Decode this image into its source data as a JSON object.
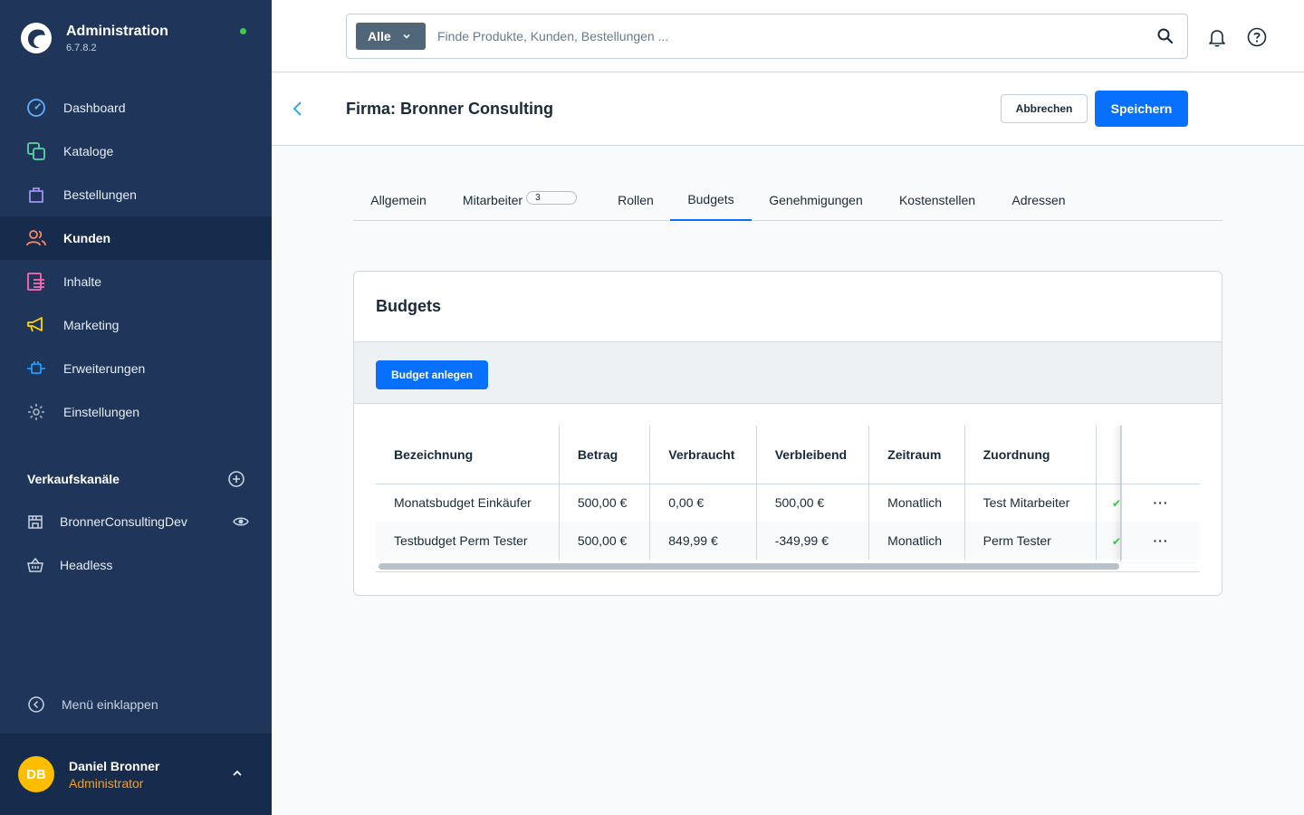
{
  "app": {
    "title": "Administration",
    "version": "6.7.8.2"
  },
  "sidebar": {
    "items": [
      {
        "label": "Dashboard",
        "icon": "dashboard-icon",
        "color": "#5fb0ff"
      },
      {
        "label": "Kataloge",
        "icon": "catalog-icon",
        "color": "#57d9a3"
      },
      {
        "label": "Bestellungen",
        "icon": "shopping-bag-icon",
        "color": "#a092f0"
      },
      {
        "label": "Kunden",
        "icon": "users-icon",
        "color": "#f88962",
        "active": true
      },
      {
        "label": "Inhalte",
        "icon": "content-icon",
        "color": "#ff68b4"
      },
      {
        "label": "Marketing",
        "icon": "megaphone-icon",
        "color": "#ffd700"
      },
      {
        "label": "Erweiterungen",
        "icon": "plug-icon",
        "color": "#189eff"
      },
      {
        "label": "Einstellungen",
        "icon": "gear-icon",
        "color": "#9aa8b5"
      }
    ],
    "sales_channels_title": "Verkaufskanäle",
    "sales_channels": [
      {
        "label": "BronnerConsultingDev",
        "icon": "storefront-icon"
      },
      {
        "label": "Headless",
        "icon": "basket-icon"
      }
    ],
    "collapse_label": "Menü einklappen"
  },
  "user": {
    "initials": "DB",
    "name": "Daniel Bronner",
    "role": "Administrator"
  },
  "search": {
    "type": "Alle",
    "placeholder": "Finde Produkte, Kunden, Bestellungen ..."
  },
  "page": {
    "title": "Firma: Bronner Consulting",
    "cancel": "Abbrechen",
    "save": "Speichern"
  },
  "tabs": [
    {
      "label": "Allgemein"
    },
    {
      "label": "Mitarbeiter",
      "badge": "3"
    },
    {
      "label": "Rollen"
    },
    {
      "label": "Budgets",
      "active": true
    },
    {
      "label": "Genehmigungen"
    },
    {
      "label": "Kostenstellen"
    },
    {
      "label": "Adressen"
    }
  ],
  "budgets": {
    "title": "Budgets",
    "create_button": "Budget anlegen",
    "columns": [
      "Bezeichnung",
      "Betrag",
      "Verbraucht",
      "Verbleibend",
      "Zeitraum",
      "Zuordnung"
    ],
    "rows": [
      {
        "name": "Monatsbudget Einkäufer",
        "amount": "500,00 €",
        "used": "0,00 €",
        "remaining": "500,00 €",
        "period": "Monatlich",
        "assignment": "Test Mitarbeiter"
      },
      {
        "name": "Testbudget Perm Tester",
        "amount": "500,00 €",
        "used": "849,99 €",
        "remaining": "-349,99 €",
        "period": "Monatlich",
        "assignment": "Perm Tester"
      }
    ]
  },
  "colors": {
    "sidebar": "#1f355a",
    "sidebar_active": "#172b4d",
    "primary": "#0870ff",
    "status_online": "#37d046",
    "role": "#ff9f0a"
  }
}
